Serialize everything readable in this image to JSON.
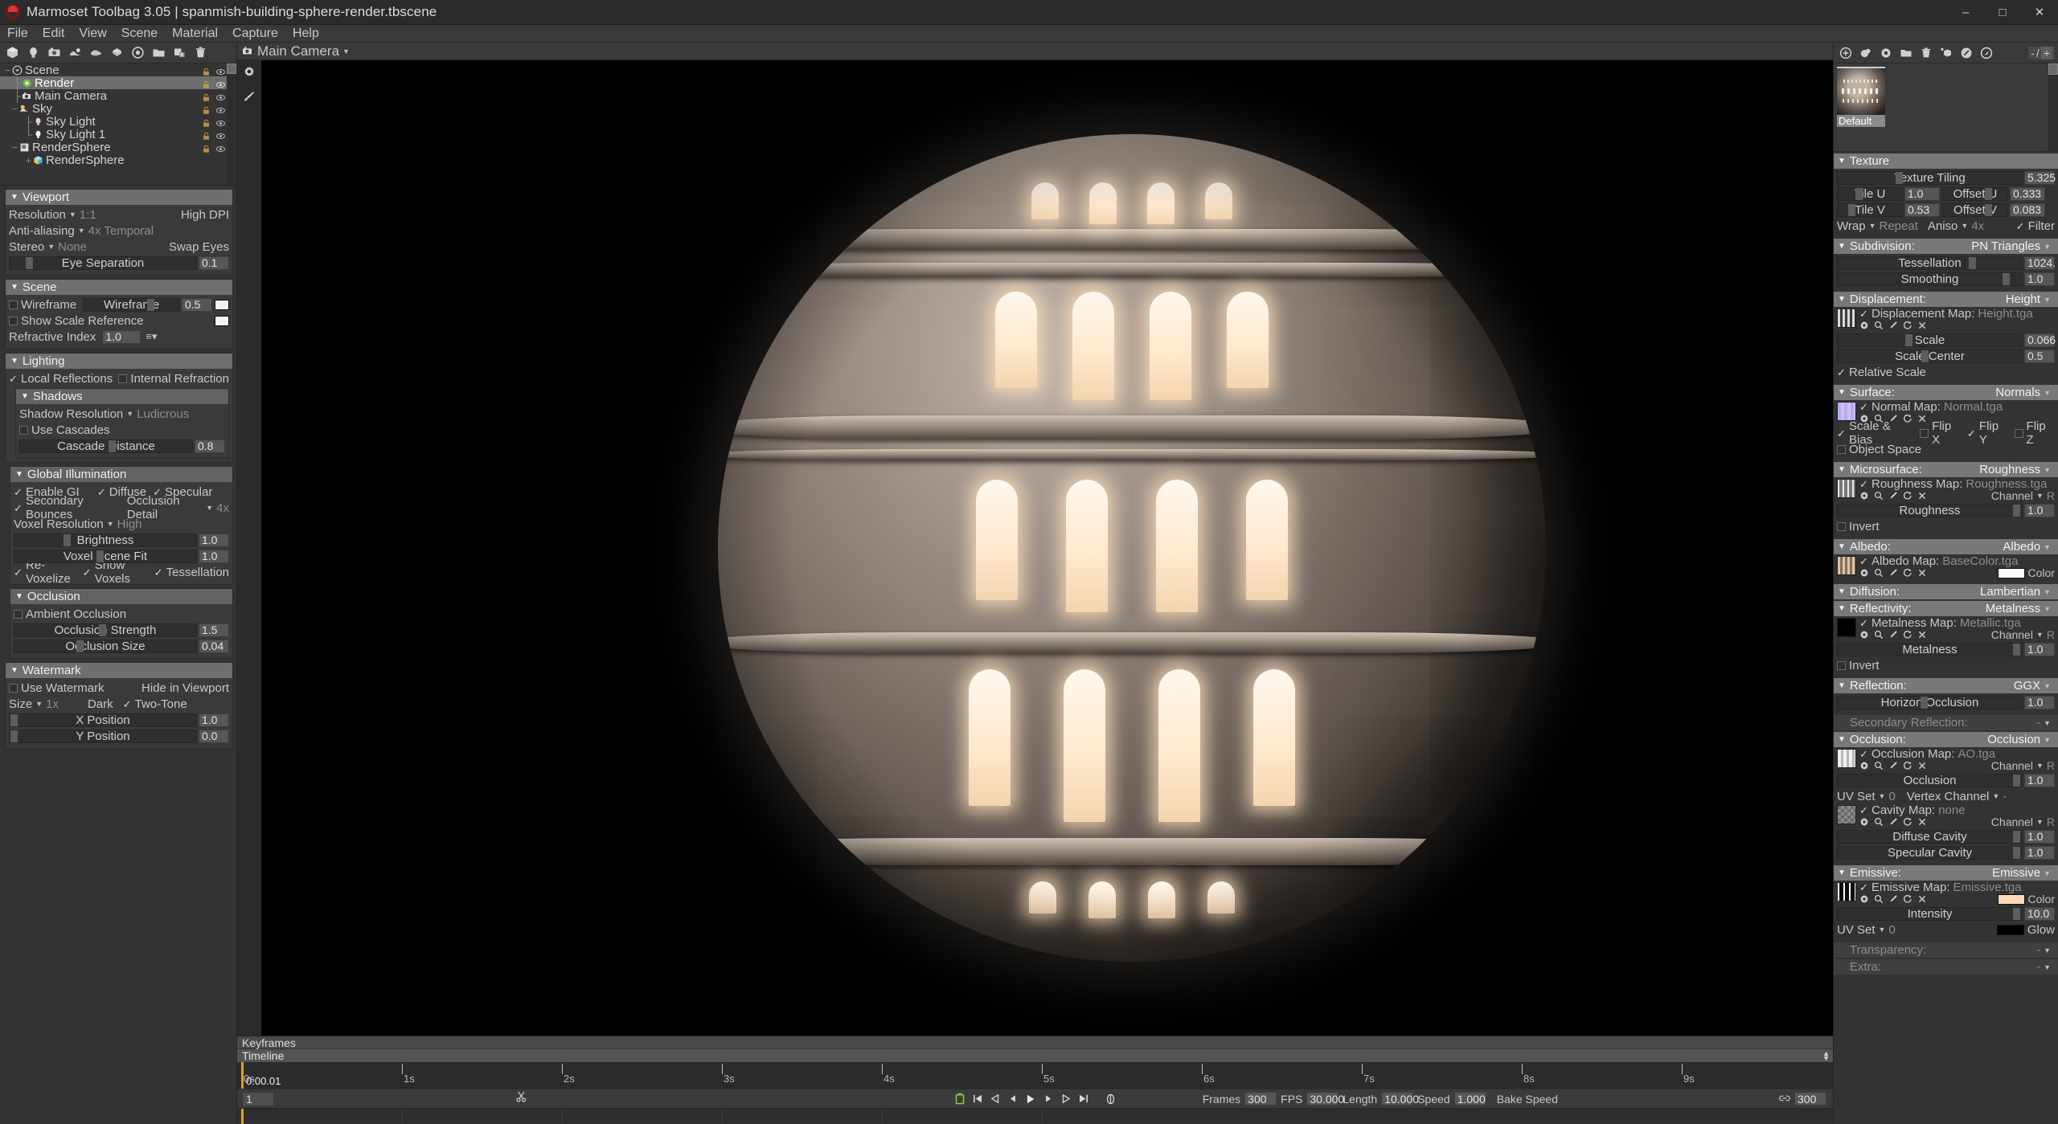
{
  "titlebar": {
    "app_title": "Marmoset Toolbag 3.05  |  spanmish-building-sphere-render.tbscene",
    "minimize": "–",
    "maximize": "□",
    "close": "✕"
  },
  "menubar": {
    "items": [
      "File",
      "Edit",
      "View",
      "Scene",
      "Material",
      "Capture",
      "Help"
    ]
  },
  "object_toolbar": {
    "icons": [
      "mesh-icon",
      "light-icon",
      "camera-icon",
      "sky-icon",
      "fog-icon",
      "turntable-icon",
      "render-icon",
      "folder-icon",
      "duplicate-icon",
      "delete-icon"
    ]
  },
  "scene_tree": {
    "rows": [
      {
        "label": "Scene",
        "indent": 0,
        "twisty": "−",
        "icon": "scene-icon",
        "selected": false
      },
      {
        "label": "Render",
        "indent": 1,
        "twisty": "├",
        "icon": "render-icon",
        "selected": true
      },
      {
        "label": "Main Camera",
        "indent": 1,
        "twisty": "├",
        "icon": "camera-icon",
        "selected": false
      },
      {
        "label": "Sky",
        "indent": 1,
        "twisty": "−",
        "icon": "sky-icon",
        "selected": false
      },
      {
        "label": "Sky Light",
        "indent": 2,
        "twisty": "├",
        "icon": "light-icon",
        "selected": false
      },
      {
        "label": "Sky Light 1",
        "indent": 2,
        "twisty": "└",
        "icon": "light-icon",
        "selected": false
      },
      {
        "label": "RenderSphere",
        "indent": 1,
        "twisty": "−",
        "icon": "object-icon",
        "selected": false
      },
      {
        "label": "RenderSphere",
        "indent": 2,
        "twisty": "+",
        "icon": "mesh-icon",
        "selected": false
      }
    ]
  },
  "viewport_panel": {
    "title": "Viewport",
    "resolution_label": "Resolution",
    "resolution_value": "1:1",
    "high_dpi": "High DPI",
    "antialiasing_label": "Anti-aliasing",
    "antialiasing_value": "4x Temporal",
    "stereo_label": "Stereo",
    "stereo_value": "None",
    "eye_separation_label": "Eye Separation",
    "eye_separation_value": "0.1",
    "swap_eyes": "Swap Eyes"
  },
  "scene_panel": {
    "title": "Scene",
    "wireframe_label": "Wireframe",
    "wireframe_slider_label": "Wireframe",
    "wireframe_value": "0.5",
    "show_scale_reference": "Show Scale Reference",
    "refractive_index_label": "Refractive Index",
    "refractive_index_value": "1.0"
  },
  "lighting_panel": {
    "title": "Lighting",
    "local_reflections": "Local Reflections",
    "internal_refraction": "Internal Refraction",
    "shadows_title": "Shadows",
    "shadow_resolution_label": "Shadow Resolution",
    "shadow_resolution_value": "Ludicrous",
    "use_cascades": "Use Cascades",
    "cascade_distance_label": "Cascade Distance",
    "cascade_distance_value": "0.8"
  },
  "gi_panel": {
    "title": "Global Illumination",
    "enable_gi": "Enable GI",
    "diffuse": "Diffuse",
    "specular": "Specular",
    "secondary_bounces": "Secondary Bounces",
    "occlusion_detail_label": "Occlusion Detail",
    "occlusion_detail_value": "4x",
    "voxel_resolution_label": "Voxel Resolution",
    "voxel_resolution_value": "High",
    "brightness_label": "Brightness",
    "brightness_value": "1.0",
    "voxel_scene_fit_label": "Voxel Scene Fit",
    "voxel_scene_fit_value": "1.0",
    "re_voxelize": "Re-Voxelize",
    "show_voxels": "Show Voxels",
    "tessellation": "Tessellation"
  },
  "occlusion_panel": {
    "title": "Occlusion",
    "ambient_occlusion": "Ambient Occlusion",
    "strength_label": "Occlusion Strength",
    "strength_value": "1.5",
    "size_label": "Occlusion Size",
    "size_value": "0.04"
  },
  "watermark_panel": {
    "title": "Watermark",
    "use_watermark": "Use Watermark",
    "hide_in_viewport": "Hide in Viewport",
    "size_label": "Size",
    "size_value": "1x",
    "dark": "Dark",
    "two_tone": "Two-Tone",
    "x_position_label": "X Position",
    "x_position_value": "1.0",
    "y_position_label": "Y Position",
    "y_position_value": "0.0"
  },
  "viewport": {
    "camera_name": "Main Camera",
    "side_icons": [
      "gear-icon",
      "brush-icon"
    ]
  },
  "timeline": {
    "keyframes_label": "Keyframes",
    "timeline_label": "Timeline",
    "current_time": "0:00.01",
    "current_frame": "1",
    "ticks": [
      "0s",
      "1s",
      "2s",
      "3s",
      "4s",
      "5s",
      "6s",
      "7s",
      "8s",
      "9s"
    ],
    "transport": [
      "record-icon",
      "jump-start-icon",
      "prev-key-icon",
      "step-back-icon",
      "play-icon",
      "step-forward-icon",
      "next-key-icon",
      "jump-end-icon",
      "loop-icon"
    ],
    "frames_label": "Frames",
    "frames_value": "300",
    "fps_label": "FPS",
    "fps_value": "30.000",
    "length_label": "Length",
    "length_value": "10.000",
    "speed_label": "Speed",
    "speed_value": "1.000",
    "bake_speed_label": "Bake Speed",
    "link_value": "300",
    "scissors_icon": "scissors-icon",
    "link_icon": "link-icon"
  },
  "material_toolbar": {
    "icons": [
      "add-material-icon",
      "duplicate-material-icon",
      "settings-icon",
      "folder-icon",
      "delete-icon",
      "assign-icon",
      "preview-sphere-icon",
      "preview-flat-icon"
    ],
    "zoom_minus": "-",
    "zoom_sep": "/",
    "zoom_plus": "+"
  },
  "material_list": {
    "items": [
      {
        "name": "Default",
        "selected": true
      }
    ]
  },
  "material": {
    "texture": {
      "title": "Texture",
      "tiling_label": "Texture Tiling",
      "tiling_value": "5.325",
      "tile_u_label": "Tile U",
      "tile_u_value": "1.0",
      "offset_u_label": "Offset U",
      "offset_u_value": "0.333",
      "tile_v_label": "Tile V",
      "tile_v_value": "0.53",
      "offset_v_label": "Offset V",
      "offset_v_value": "0.083",
      "wrap_label": "Wrap",
      "wrap_value": "Repeat",
      "aniso_label": "Aniso",
      "aniso_value": "4x",
      "filter_label": "Filter"
    },
    "subdivision": {
      "title": "Subdivision:",
      "mode": "PN Triangles",
      "tessellation_label": "Tessellation",
      "tessellation_value": "1024.",
      "smoothing_label": "Smoothing",
      "smoothing_value": "1.0"
    },
    "displacement": {
      "title": "Displacement:",
      "mode": "Height",
      "map_label": "Displacement Map:",
      "map_file": "Height.tga",
      "scale_label": "Scale",
      "scale_value": "0.066",
      "scale_center_label": "Scale Center",
      "scale_center_value": "0.5",
      "relative_scale": "Relative Scale"
    },
    "surface": {
      "title": "Surface:",
      "mode": "Normals",
      "map_label": "Normal Map:",
      "map_file": "Normal.tga",
      "scale_bias": "Scale & Bias",
      "flip_x": "Flip X",
      "flip_y": "Flip Y",
      "flip_z": "Flip Z",
      "object_space": "Object Space"
    },
    "microsurface": {
      "title": "Microsurface:",
      "mode": "Roughness",
      "map_label": "Roughness Map:",
      "map_file": "Roughness.tga",
      "channel_label": "Channel",
      "channel_value": "R",
      "slider_label": "Roughness",
      "slider_value": "1.0",
      "invert": "Invert"
    },
    "albedo": {
      "title": "Albedo:",
      "mode": "Albedo",
      "map_label": "Albedo Map:",
      "map_file": "BaseColor.tga",
      "color_label": "Color",
      "color_hex": "#ffffff"
    },
    "diffusion": {
      "title": "Diffusion:",
      "mode": "Lambertian"
    },
    "reflectivity": {
      "title": "Reflectivity:",
      "mode": "Metalness",
      "map_label": "Metalness Map:",
      "map_file": "Metallic.tga",
      "channel_label": "Channel",
      "channel_value": "R",
      "slider_label": "Metalness",
      "slider_value": "1.0",
      "invert": "Invert"
    },
    "reflection": {
      "title": "Reflection:",
      "mode": "GGX",
      "horizon_label": "Horizon Occlusion",
      "horizon_value": "1.0"
    },
    "secondary_reflection": {
      "title": "Secondary Reflection:",
      "mode": "-"
    },
    "occlusion": {
      "title": "Occlusion:",
      "mode": "Occlusion",
      "map_label": "Occlusion Map:",
      "map_file": "AO.tga",
      "channel_label": "Channel",
      "channel_value": "R",
      "slider_label": "Occlusion",
      "slider_value": "1.0",
      "uv_set_label": "UV Set",
      "uv_set_value": "0",
      "vertex_channel_label": "Vertex Channel",
      "vertex_channel_value": "-",
      "cavity_map_label": "Cavity Map:",
      "cavity_map_file": "none",
      "cavity_channel_label": "Channel",
      "cavity_channel_value": "R",
      "diffuse_cavity_label": "Diffuse Cavity",
      "diffuse_cavity_value": "1.0",
      "specular_cavity_label": "Specular Cavity",
      "specular_cavity_value": "1.0"
    },
    "emissive": {
      "title": "Emissive:",
      "mode": "Emissive",
      "map_label": "Emissive Map:",
      "map_file": "Emissive.tga",
      "color_label": "Color",
      "color_hex": "#ffd9b8",
      "intensity_label": "Intensity",
      "intensity_value": "10.0",
      "uv_set_label": "UV Set",
      "uv_set_value": "0",
      "glow_label": "Glow",
      "glow_hex": "#000000"
    },
    "transparency": {
      "title": "Transparency:",
      "mode": "-"
    },
    "extra": {
      "title": "Extra:",
      "mode": "-"
    }
  }
}
